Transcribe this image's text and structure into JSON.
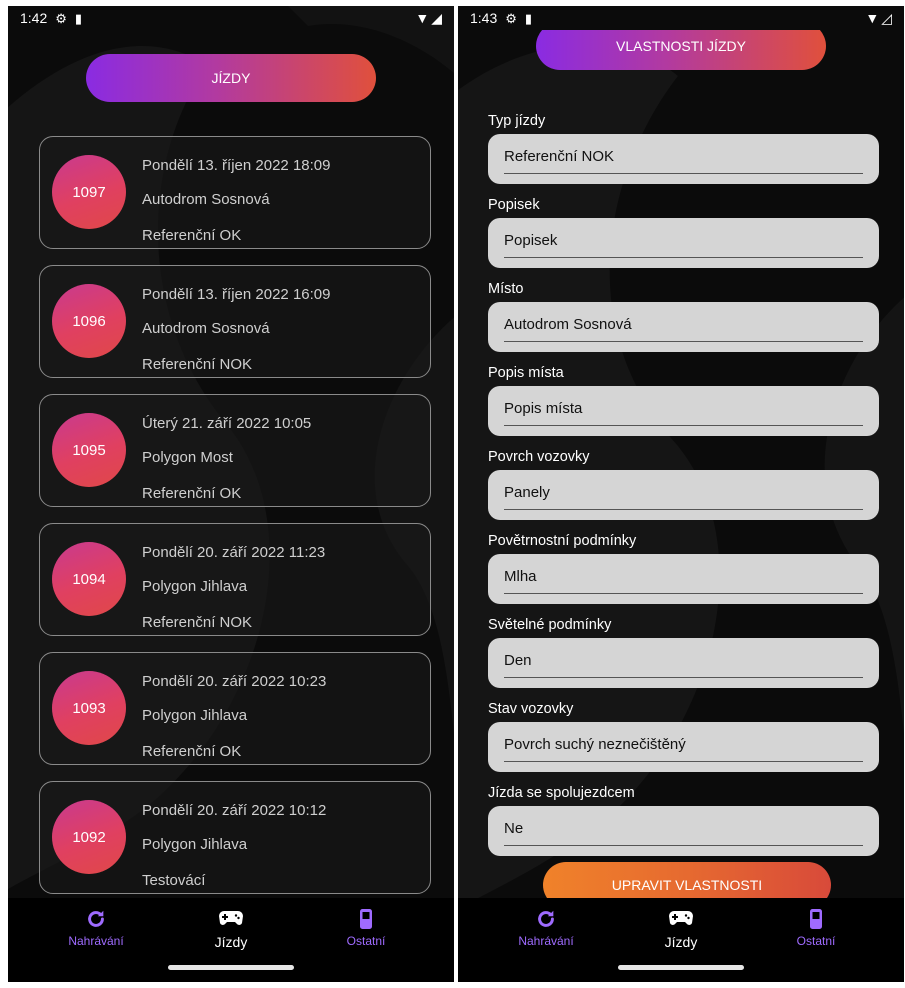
{
  "screens": [
    {
      "status": {
        "time": "1:42"
      },
      "header": {
        "title": "JÍZDY"
      },
      "rides": [
        {
          "id": "1097",
          "date": "Pondělí 13. říjen 2022 18:09",
          "location": "Autodrom Sosnová",
          "type": "Referenční OK"
        },
        {
          "id": "1096",
          "date": "Pondělí 13. říjen 2022 16:09",
          "location": "Autodrom Sosnová",
          "type": "Referenční NOK"
        },
        {
          "id": "1095",
          "date": "Úterý 21. září 2022 10:05",
          "location": "Polygon Most",
          "type": "Referenční OK"
        },
        {
          "id": "1094",
          "date": "Pondělí 20. září 2022 11:23",
          "location": "Polygon Jihlava",
          "type": "Referenční NOK"
        },
        {
          "id": "1093",
          "date": "Pondělí 20. září 2022 10:23",
          "location": "Polygon Jihlava",
          "type": "Referenční OK"
        },
        {
          "id": "1092",
          "date": "Pondělí 20. září 2022 10:12",
          "location": "Polygon Jihlava",
          "type": "Testovácí"
        }
      ],
      "nav": {
        "item1": "Nahrávání",
        "item2": "Jízdy",
        "item3": "Ostatní"
      }
    },
    {
      "status": {
        "time": "1:43"
      },
      "header": {
        "title": "VLASTNOSTI JÍZDY"
      },
      "fields": [
        {
          "label": "Typ jízdy",
          "value": "Referenční NOK"
        },
        {
          "label": "Popisek",
          "value": "Popisek"
        },
        {
          "label": "Místo",
          "value": "Autodrom Sosnová"
        },
        {
          "label": "Popis místa",
          "value": "Popis místa"
        },
        {
          "label": "Povrch vozovky",
          "value": "Panely"
        },
        {
          "label": "Povětrnostní podmínky",
          "value": "Mlha"
        },
        {
          "label": "Světelné podmínky",
          "value": "Den"
        },
        {
          "label": "Stav vozovky",
          "value": "Povrch suchý neznečištěný"
        },
        {
          "label": "Jízda se spolujezdcem",
          "value": "Ne"
        }
      ],
      "button": {
        "label": "UPRAVIT VLASTNOSTI"
      },
      "nav": {
        "item1": "Nahrávání",
        "item2": "Jízdy",
        "item3": "Ostatní"
      }
    }
  ],
  "icons": {
    "status": [
      "settings-gear-icon",
      "sd-card-icon",
      "wifi-icon",
      "signal-icon"
    ],
    "nav": [
      "refresh-icon",
      "gamepad-icon",
      "mobile-phone-icon"
    ]
  },
  "colors": {
    "background": "#0b0b0b",
    "gradient_purple": "#8a2be2",
    "gradient_red": "#e0503c",
    "button_orange": "#f0822a",
    "nav_inactive": "#9f6bff",
    "field_bg": "#d5d5d5"
  }
}
